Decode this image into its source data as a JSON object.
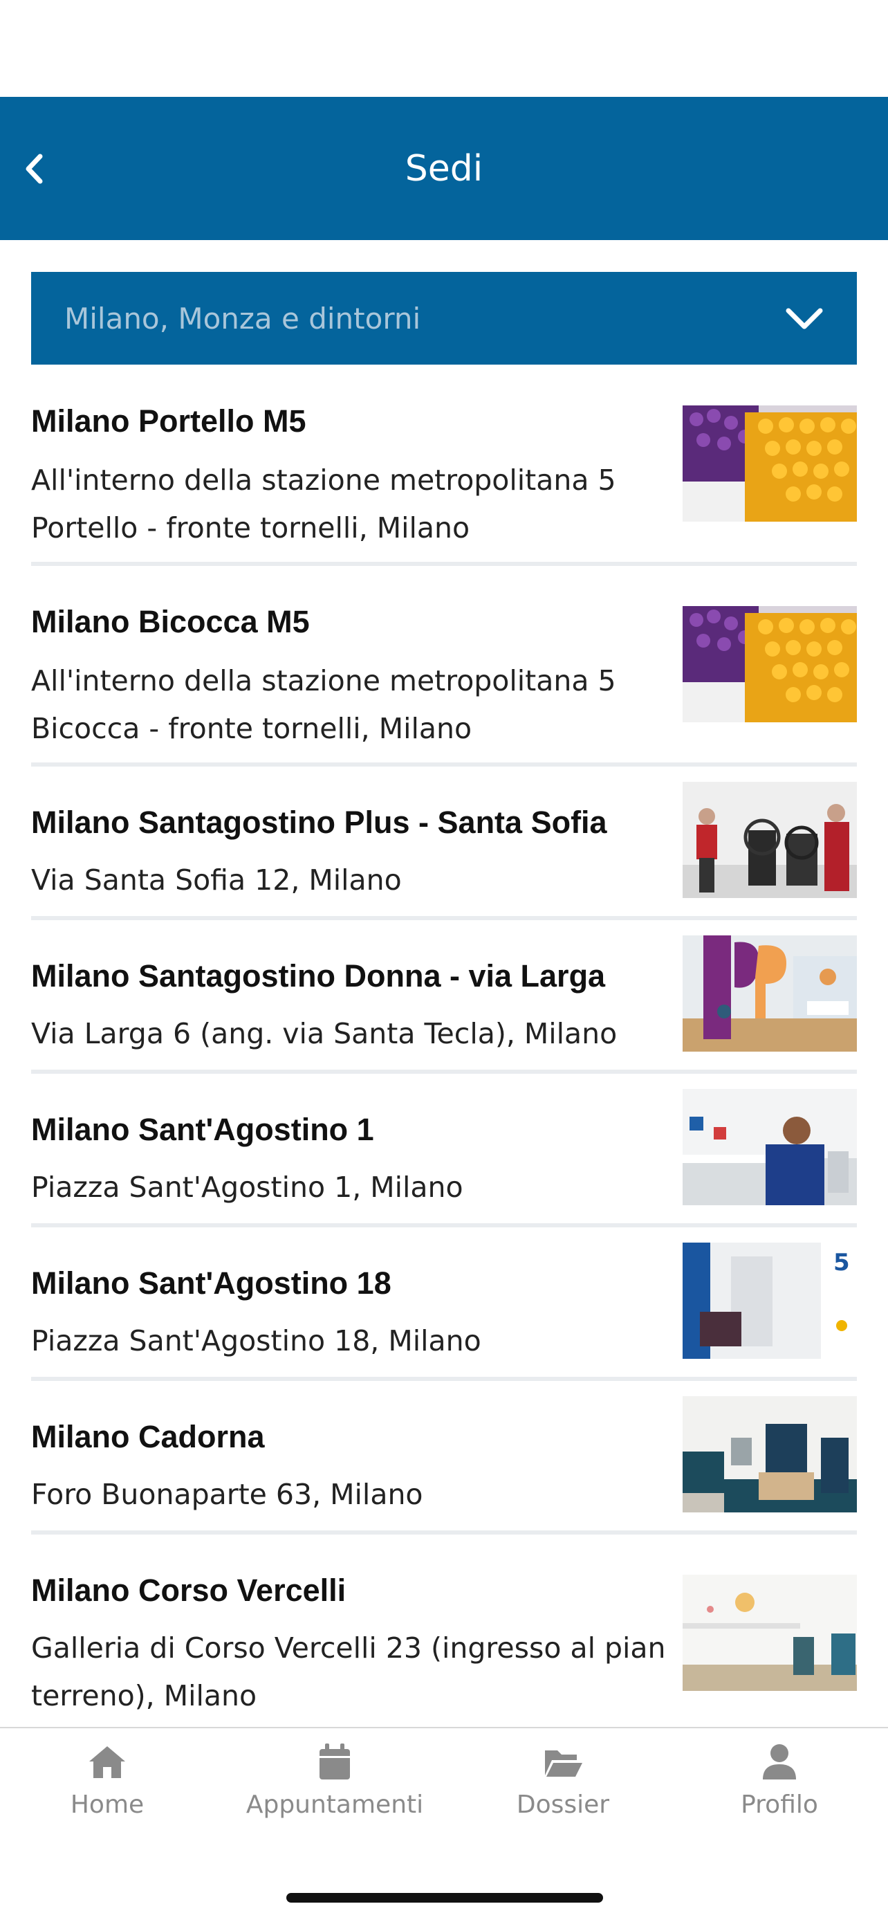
{
  "header": {
    "title": "Sedi",
    "back_icon": "chevron-left-icon"
  },
  "region_select": {
    "value": "Milano, Monza e dintorni",
    "icon": "chevron-down-icon"
  },
  "locations": [
    {
      "name": "Milano Portello M5",
      "address": "All'interno della stazione metropolitana 5 Portello - fronte tornelli, Milano",
      "image": "blood-sample-tubes-photo"
    },
    {
      "name": "Milano Bicocca M5",
      "address": "All'interno della stazione metropolitana 5 Bicocca - fronte tornelli, Milano",
      "image": "blood-sample-tubes-photo"
    },
    {
      "name": "Milano Santagostino Plus - Santa Sofia",
      "address": "Via Santa Sofia 12, Milano",
      "image": "gym-staff-photo"
    },
    {
      "name": "Milano Santagostino Donna - via Larga",
      "address": "Via Larga 6 (ang. via Santa Tecla), Milano",
      "image": "reception-logo-photo"
    },
    {
      "name": "Milano Sant'Agostino 1",
      "address": "Piazza Sant'Agostino 1, Milano",
      "image": "desk-consultation-photo"
    },
    {
      "name": "Milano Sant'Agostino 18",
      "address": "Piazza Sant'Agostino 18, Milano",
      "image": "corridor-waiting-photo"
    },
    {
      "name": "Milano Cadorna",
      "address": "Foro Buonaparte 63, Milano",
      "image": "armchairs-waiting-room-photo"
    },
    {
      "name": "Milano Corso Vercelli",
      "address": "Galleria di Corso Vercelli 23 (ingresso al pian terreno), Milano",
      "image": "white-waiting-room-photo"
    }
  ],
  "tabbar": {
    "tabs": [
      {
        "label": "Home",
        "icon": "home-icon"
      },
      {
        "label": "Appuntamenti",
        "icon": "calendar-icon"
      },
      {
        "label": "Dossier",
        "icon": "folder-open-icon"
      },
      {
        "label": "Profilo",
        "icon": "user-icon"
      }
    ]
  },
  "colors": {
    "brand_blue": "#04649c",
    "select_text": "#a9c6da",
    "tab_gray": "#8a8a8a",
    "divider": "#e9ecef"
  }
}
